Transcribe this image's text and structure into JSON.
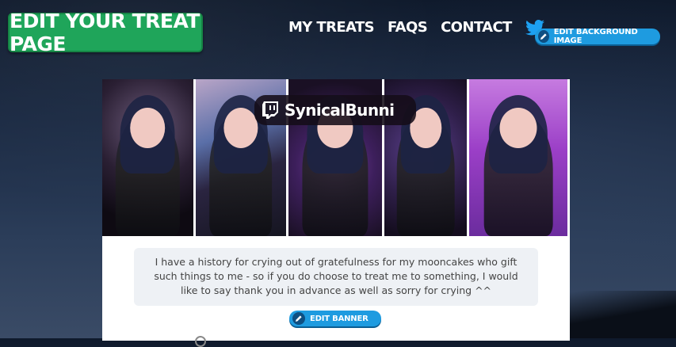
{
  "header": {
    "edit_treat_label": "EDIT YOUR TREAT PAGE",
    "nav": [
      "MY TREATS",
      "FAQS",
      "CONTACT"
    ],
    "social_icon": "twitter-icon",
    "edit_background_label": "EDIT BACKGROUND IMAGE"
  },
  "banner": {
    "streamer_name": "SynicalBunni",
    "platform_icon": "twitch-icon"
  },
  "bio": {
    "text": "I have a history for crying out of gratefulness for my mooncakes who gift such things to me - so if you do choose to treat me to something, I would like to say thank you in advance as well as sorry for crying ^^"
  },
  "actions": {
    "edit_banner_label": "EDIT BANNER"
  },
  "colors": {
    "accent_green": "#1fa55a",
    "accent_blue": "#1e9be0",
    "twitter_blue": "#1da1f2"
  }
}
